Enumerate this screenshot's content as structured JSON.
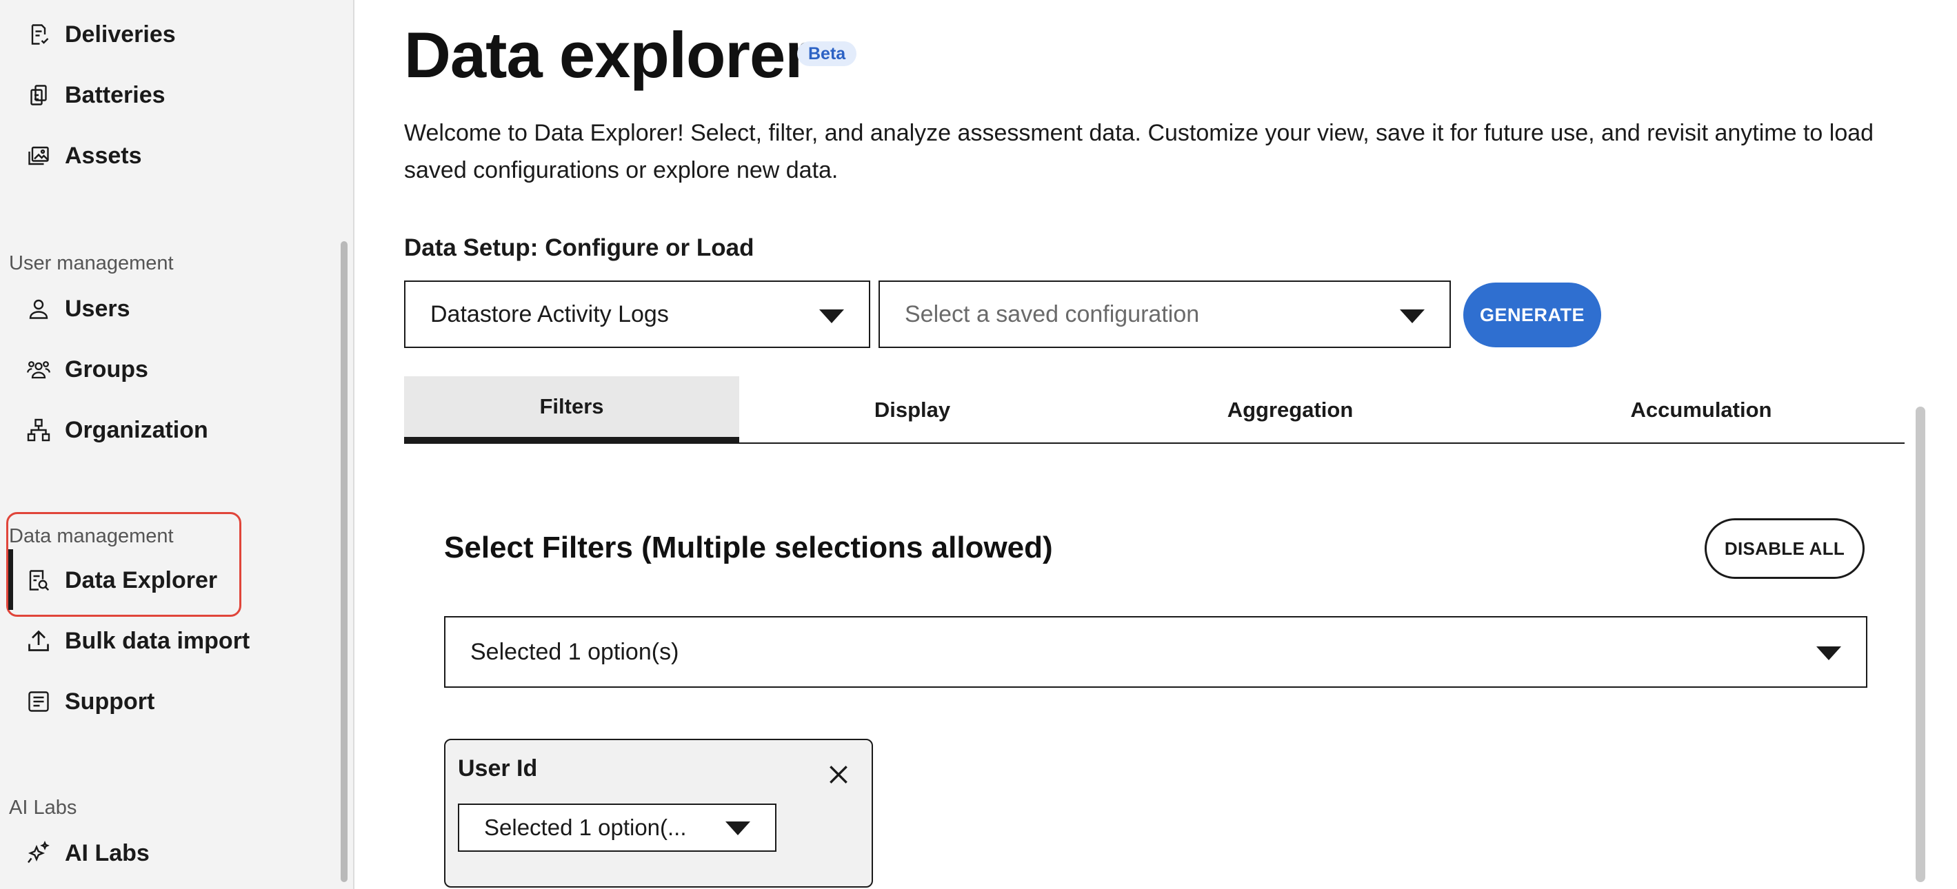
{
  "sidebar": {
    "top_items": [
      {
        "label": "Deliveries",
        "icon": "deliveries-icon"
      },
      {
        "label": "Batteries",
        "icon": "batteries-icon"
      },
      {
        "label": "Assets",
        "icon": "assets-icon"
      }
    ],
    "user_management": {
      "label": "User management",
      "items": [
        {
          "label": "Users",
          "icon": "user-icon"
        },
        {
          "label": "Groups",
          "icon": "groups-icon"
        },
        {
          "label": "Organization",
          "icon": "organization-icon"
        }
      ]
    },
    "data_management": {
      "label": "Data management",
      "items": [
        {
          "label": "Data Explorer",
          "icon": "data-explorer-icon",
          "active": true
        },
        {
          "label": "Bulk data import",
          "icon": "upload-icon"
        },
        {
          "label": "Support",
          "icon": "support-icon"
        }
      ]
    },
    "ai_labs": {
      "label": "AI Labs",
      "items": [
        {
          "label": "AI Labs",
          "icon": "sparkle-icon"
        }
      ]
    },
    "highlight_color": "#e0453a"
  },
  "main": {
    "title": "Data explorer",
    "badge": "Beta",
    "intro": "Welcome to Data Explorer! Select, filter, and analyze assessment data. Customize your view, save it for future use, and revisit anytime to load saved configurations or explore new data.",
    "setup_label": "Data Setup: Configure or Load",
    "datasource_select": {
      "value": "Datastore Activity Logs"
    },
    "config_select": {
      "placeholder": "Select a saved configuration"
    },
    "generate_label": "GENERATE",
    "tabs": [
      {
        "label": "Filters",
        "active": true
      },
      {
        "label": "Display"
      },
      {
        "label": "Aggregation"
      },
      {
        "label": "Accumulation"
      }
    ],
    "filters": {
      "title": "Select Filters (Multiple selections allowed)",
      "disable_all_label": "DISABLE ALL",
      "select_value": "Selected 1 option(s)",
      "cards": [
        {
          "title": "User Id",
          "select_value": "Selected 1 option(..."
        }
      ]
    },
    "accent_color": "#2f6fd0"
  }
}
